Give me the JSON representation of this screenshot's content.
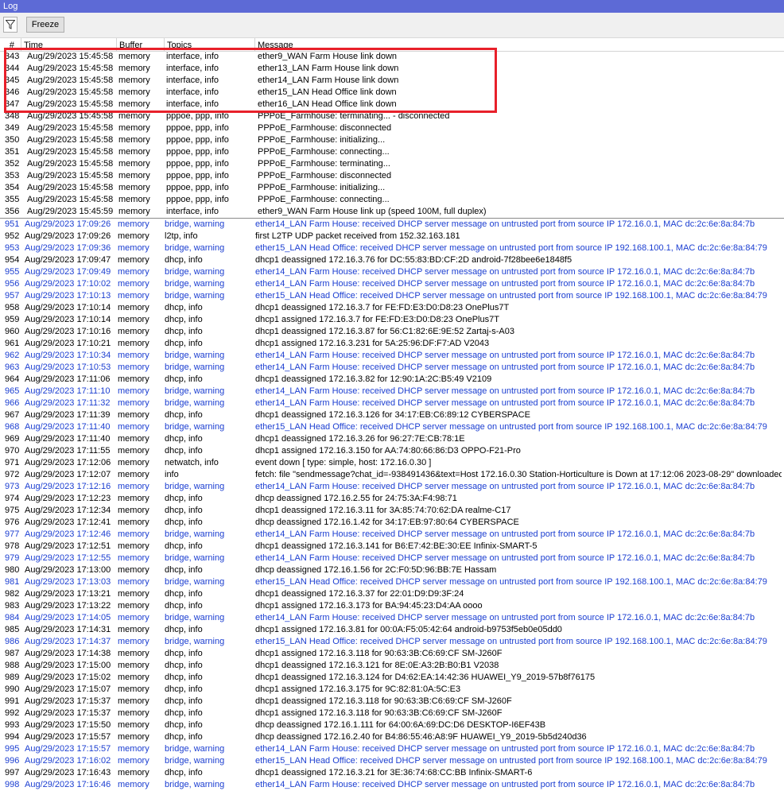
{
  "window": {
    "title": "Log"
  },
  "toolbar": {
    "freeze_label": "Freeze"
  },
  "columns": {
    "num": "#",
    "time": "Time",
    "buffer": "Buffer",
    "topics": "Topics",
    "message": "Message"
  },
  "colors": {
    "titlebar": "#5d6ad6",
    "highlight": "#e8202a",
    "warning_text": "#1b3ed1"
  },
  "rows": [
    {
      "n": "343",
      "t": "Aug/29/2023 15:45:58",
      "b": "memory",
      "tp": "interface, info",
      "m": "ether9_WAN Farm House link down",
      "w": false
    },
    {
      "n": "344",
      "t": "Aug/29/2023 15:45:58",
      "b": "memory",
      "tp": "interface, info",
      "m": "ether13_LAN Farm House link down",
      "w": false
    },
    {
      "n": "345",
      "t": "Aug/29/2023 15:45:58",
      "b": "memory",
      "tp": "interface, info",
      "m": "ether14_LAN Farm House link down",
      "w": false
    },
    {
      "n": "346",
      "t": "Aug/29/2023 15:45:58",
      "b": "memory",
      "tp": "interface, info",
      "m": "ether15_LAN Head Office link down",
      "w": false
    },
    {
      "n": "347",
      "t": "Aug/29/2023 15:45:58",
      "b": "memory",
      "tp": "interface, info",
      "m": "ether16_LAN Head Office link down",
      "w": false
    },
    {
      "n": "348",
      "t": "Aug/29/2023 15:45:58",
      "b": "memory",
      "tp": "pppoe, ppp, info",
      "m": "PPPoE_Farmhouse: terminating... - disconnected",
      "w": false
    },
    {
      "n": "349",
      "t": "Aug/29/2023 15:45:58",
      "b": "memory",
      "tp": "pppoe, ppp, info",
      "m": "PPPoE_Farmhouse: disconnected",
      "w": false
    },
    {
      "n": "350",
      "t": "Aug/29/2023 15:45:58",
      "b": "memory",
      "tp": "pppoe, ppp, info",
      "m": "PPPoE_Farmhouse: initializing...",
      "w": false
    },
    {
      "n": "351",
      "t": "Aug/29/2023 15:45:58",
      "b": "memory",
      "tp": "pppoe, ppp, info",
      "m": "PPPoE_Farmhouse: connecting...",
      "w": false
    },
    {
      "n": "352",
      "t": "Aug/29/2023 15:45:58",
      "b": "memory",
      "tp": "pppoe, ppp, info",
      "m": "PPPoE_Farmhouse: terminating...",
      "w": false
    },
    {
      "n": "353",
      "t": "Aug/29/2023 15:45:58",
      "b": "memory",
      "tp": "pppoe, ppp, info",
      "m": "PPPoE_Farmhouse: disconnected",
      "w": false
    },
    {
      "n": "354",
      "t": "Aug/29/2023 15:45:58",
      "b": "memory",
      "tp": "pppoe, ppp, info",
      "m": "PPPoE_Farmhouse: initializing...",
      "w": false
    },
    {
      "n": "355",
      "t": "Aug/29/2023 15:45:58",
      "b": "memory",
      "tp": "pppoe, ppp, info",
      "m": "PPPoE_Farmhouse: connecting...",
      "w": false
    },
    {
      "n": "356",
      "t": "Aug/29/2023 15:45:59",
      "b": "memory",
      "tp": "interface, info",
      "m": "ether9_WAN Farm House link up (speed 100M, full duplex)",
      "w": false
    },
    {
      "n": "951",
      "t": "Aug/29/2023 17:09:26",
      "b": "memory",
      "tp": "bridge, warning",
      "m": "ether14_LAN Farm House: received DHCP server message on untrusted port from source IP 172.16.0.1, MAC dc:2c:6e:8a:84:7b",
      "w": true
    },
    {
      "n": "952",
      "t": "Aug/29/2023 17:09:26",
      "b": "memory",
      "tp": "l2tp, info",
      "m": "first L2TP UDP packet received from 152.32.163.181",
      "w": false
    },
    {
      "n": "953",
      "t": "Aug/29/2023 17:09:36",
      "b": "memory",
      "tp": "bridge, warning",
      "m": "ether15_LAN Head Office: received DHCP server message on untrusted port from source IP 192.168.100.1, MAC dc:2c:6e:8a:84:79",
      "w": true
    },
    {
      "n": "954",
      "t": "Aug/29/2023 17:09:47",
      "b": "memory",
      "tp": "dhcp, info",
      "m": "dhcp1 deassigned 172.16.3.76 for DC:55:83:BD:CF:2D android-7f28bee6e1848f5",
      "w": false
    },
    {
      "n": "955",
      "t": "Aug/29/2023 17:09:49",
      "b": "memory",
      "tp": "bridge, warning",
      "m": "ether14_LAN Farm House: received DHCP server message on untrusted port from source IP 172.16.0.1, MAC dc:2c:6e:8a:84:7b",
      "w": true
    },
    {
      "n": "956",
      "t": "Aug/29/2023 17:10:02",
      "b": "memory",
      "tp": "bridge, warning",
      "m": "ether14_LAN Farm House: received DHCP server message on untrusted port from source IP 172.16.0.1, MAC dc:2c:6e:8a:84:7b",
      "w": true
    },
    {
      "n": "957",
      "t": "Aug/29/2023 17:10:13",
      "b": "memory",
      "tp": "bridge, warning",
      "m": "ether15_LAN Head Office: received DHCP server message on untrusted port from source IP 192.168.100.1, MAC dc:2c:6e:8a:84:79",
      "w": true
    },
    {
      "n": "958",
      "t": "Aug/29/2023 17:10:14",
      "b": "memory",
      "tp": "dhcp, info",
      "m": "dhcp1 deassigned 172.16.3.7 for FE:FD:E3:D0:D8:23 OnePlus7T",
      "w": false
    },
    {
      "n": "959",
      "t": "Aug/29/2023 17:10:14",
      "b": "memory",
      "tp": "dhcp, info",
      "m": "dhcp1 assigned 172.16.3.7 for FE:FD:E3:D0:D8:23 OnePlus7T",
      "w": false
    },
    {
      "n": "960",
      "t": "Aug/29/2023 17:10:16",
      "b": "memory",
      "tp": "dhcp, info",
      "m": "dhcp1 deassigned 172.16.3.87 for 56:C1:82:6E:9E:52 Zartaj-s-A03",
      "w": false
    },
    {
      "n": "961",
      "t": "Aug/29/2023 17:10:21",
      "b": "memory",
      "tp": "dhcp, info",
      "m": "dhcp1 assigned 172.16.3.231 for 5A:25:96:DF:F7:AD V2043",
      "w": false
    },
    {
      "n": "962",
      "t": "Aug/29/2023 17:10:34",
      "b": "memory",
      "tp": "bridge, warning",
      "m": "ether14_LAN Farm House: received DHCP server message on untrusted port from source IP 172.16.0.1, MAC dc:2c:6e:8a:84:7b",
      "w": true
    },
    {
      "n": "963",
      "t": "Aug/29/2023 17:10:53",
      "b": "memory",
      "tp": "bridge, warning",
      "m": "ether14_LAN Farm House: received DHCP server message on untrusted port from source IP 172.16.0.1, MAC dc:2c:6e:8a:84:7b",
      "w": true
    },
    {
      "n": "964",
      "t": "Aug/29/2023 17:11:06",
      "b": "memory",
      "tp": "dhcp, info",
      "m": "dhcp1 deassigned 172.16.3.82 for 12:90:1A:2C:B5:49 V2109",
      "w": false
    },
    {
      "n": "965",
      "t": "Aug/29/2023 17:11:10",
      "b": "memory",
      "tp": "bridge, warning",
      "m": "ether14_LAN Farm House: received DHCP server message on untrusted port from source IP 172.16.0.1, MAC dc:2c:6e:8a:84:7b",
      "w": true
    },
    {
      "n": "966",
      "t": "Aug/29/2023 17:11:32",
      "b": "memory",
      "tp": "bridge, warning",
      "m": "ether14_LAN Farm House: received DHCP server message on untrusted port from source IP 172.16.0.1, MAC dc:2c:6e:8a:84:7b",
      "w": true
    },
    {
      "n": "967",
      "t": "Aug/29/2023 17:11:39",
      "b": "memory",
      "tp": "dhcp, info",
      "m": "dhcp1 deassigned 172.16.3.126 for 34:17:EB:C6:89:12 CYBERSPACE",
      "w": false
    },
    {
      "n": "968",
      "t": "Aug/29/2023 17:11:40",
      "b": "memory",
      "tp": "bridge, warning",
      "m": "ether15_LAN Head Office: received DHCP server message on untrusted port from source IP 192.168.100.1, MAC dc:2c:6e:8a:84:79",
      "w": true
    },
    {
      "n": "969",
      "t": "Aug/29/2023 17:11:40",
      "b": "memory",
      "tp": "dhcp, info",
      "m": "dhcp1 deassigned 172.16.3.26 for 96:27:7E:CB:78:1E",
      "w": false
    },
    {
      "n": "970",
      "t": "Aug/29/2023 17:11:55",
      "b": "memory",
      "tp": "dhcp, info",
      "m": "dhcp1 assigned 172.16.3.150 for AA:74:80:66:86:D3 OPPO-F21-Pro",
      "w": false
    },
    {
      "n": "971",
      "t": "Aug/29/2023 17:12:06",
      "b": "memory",
      "tp": "netwatch, info",
      "m": "event down [ type: simple, host: 172.16.0.30 ]",
      "w": false
    },
    {
      "n": "972",
      "t": "Aug/29/2023 17:12:07",
      "b": "memory",
      "tp": "info",
      "m": "fetch: file \"sendmessage?chat_id=-938491436&text=Host 172.16.0.30 Station-Horticulture is Down at 17:12:06 2023-08-29\" downloaded",
      "w": false
    },
    {
      "n": "973",
      "t": "Aug/29/2023 17:12:16",
      "b": "memory",
      "tp": "bridge, warning",
      "m": "ether14_LAN Farm House: received DHCP server message on untrusted port from source IP 172.16.0.1, MAC dc:2c:6e:8a:84:7b",
      "w": true
    },
    {
      "n": "974",
      "t": "Aug/29/2023 17:12:23",
      "b": "memory",
      "tp": "dhcp, info",
      "m": "dhcp deassigned 172.16.2.55 for 24:75:3A:F4:98:71",
      "w": false
    },
    {
      "n": "975",
      "t": "Aug/29/2023 17:12:34",
      "b": "memory",
      "tp": "dhcp, info",
      "m": "dhcp1 deassigned 172.16.3.11 for 3A:85:74:70:62:DA realme-C17",
      "w": false
    },
    {
      "n": "976",
      "t": "Aug/29/2023 17:12:41",
      "b": "memory",
      "tp": "dhcp, info",
      "m": "dhcp deassigned 172.16.1.42 for 34:17:EB:97:80:64 CYBERSPACE",
      "w": false
    },
    {
      "n": "977",
      "t": "Aug/29/2023 17:12:46",
      "b": "memory",
      "tp": "bridge, warning",
      "m": "ether14_LAN Farm House: received DHCP server message on untrusted port from source IP 172.16.0.1, MAC dc:2c:6e:8a:84:7b",
      "w": true
    },
    {
      "n": "978",
      "t": "Aug/29/2023 17:12:51",
      "b": "memory",
      "tp": "dhcp, info",
      "m": "dhcp1 deassigned 172.16.3.141 for B6:E7:42:BE:30:EE Infinix-SMART-5",
      "w": false
    },
    {
      "n": "979",
      "t": "Aug/29/2023 17:12:55",
      "b": "memory",
      "tp": "bridge, warning",
      "m": "ether14_LAN Farm House: received DHCP server message on untrusted port from source IP 172.16.0.1, MAC dc:2c:6e:8a:84:7b",
      "w": true
    },
    {
      "n": "980",
      "t": "Aug/29/2023 17:13:00",
      "b": "memory",
      "tp": "dhcp, info",
      "m": "dhcp deassigned 172.16.1.56 for 2C:F0:5D:96:BB:7E Hassam",
      "w": false
    },
    {
      "n": "981",
      "t": "Aug/29/2023 17:13:03",
      "b": "memory",
      "tp": "bridge, warning",
      "m": "ether15_LAN Head Office: received DHCP server message on untrusted port from source IP 192.168.100.1, MAC dc:2c:6e:8a:84:79",
      "w": true
    },
    {
      "n": "982",
      "t": "Aug/29/2023 17:13:21",
      "b": "memory",
      "tp": "dhcp, info",
      "m": "dhcp1 deassigned 172.16.3.37 for 22:01:D9:D9:3F:24",
      "w": false
    },
    {
      "n": "983",
      "t": "Aug/29/2023 17:13:22",
      "b": "memory",
      "tp": "dhcp, info",
      "m": "dhcp1 assigned 172.16.3.173 for BA:94:45:23:D4:AA oooo",
      "w": false
    },
    {
      "n": "984",
      "t": "Aug/29/2023 17:14:05",
      "b": "memory",
      "tp": "bridge, warning",
      "m": "ether14_LAN Farm House: received DHCP server message on untrusted port from source IP 172.16.0.1, MAC dc:2c:6e:8a:84:7b",
      "w": true
    },
    {
      "n": "985",
      "t": "Aug/29/2023 17:14:31",
      "b": "memory",
      "tp": "dhcp, info",
      "m": "dhcp1 assigned 172.16.3.81 for 00:0A:F5:05:42:64 android-b9753f5eb0e05dd0",
      "w": false
    },
    {
      "n": "986",
      "t": "Aug/29/2023 17:14:37",
      "b": "memory",
      "tp": "bridge, warning",
      "m": "ether15_LAN Head Office: received DHCP server message on untrusted port from source IP 192.168.100.1, MAC dc:2c:6e:8a:84:79",
      "w": true
    },
    {
      "n": "987",
      "t": "Aug/29/2023 17:14:38",
      "b": "memory",
      "tp": "dhcp, info",
      "m": "dhcp1 assigned 172.16.3.118 for 90:63:3B:C6:69:CF SM-J260F",
      "w": false
    },
    {
      "n": "988",
      "t": "Aug/29/2023 17:15:00",
      "b": "memory",
      "tp": "dhcp, info",
      "m": "dhcp1 deassigned 172.16.3.121 for 8E:0E:A3:2B:B0:B1 V2038",
      "w": false
    },
    {
      "n": "989",
      "t": "Aug/29/2023 17:15:02",
      "b": "memory",
      "tp": "dhcp, info",
      "m": "dhcp1 deassigned 172.16.3.124 for D4:62:EA:14:42:36 HUAWEI_Y9_2019-57b8f76175",
      "w": false
    },
    {
      "n": "990",
      "t": "Aug/29/2023 17:15:07",
      "b": "memory",
      "tp": "dhcp, info",
      "m": "dhcp1 assigned 172.16.3.175 for 9C:82:81:0A:5C:E3",
      "w": false
    },
    {
      "n": "991",
      "t": "Aug/29/2023 17:15:37",
      "b": "memory",
      "tp": "dhcp, info",
      "m": "dhcp1 deassigned 172.16.3.118 for 90:63:3B:C6:69:CF SM-J260F",
      "w": false
    },
    {
      "n": "992",
      "t": "Aug/29/2023 17:15:37",
      "b": "memory",
      "tp": "dhcp, info",
      "m": "dhcp1 assigned 172.16.3.118 for 90:63:3B:C6:69:CF SM-J260F",
      "w": false
    },
    {
      "n": "993",
      "t": "Aug/29/2023 17:15:50",
      "b": "memory",
      "tp": "dhcp, info",
      "m": "dhcp deassigned 172.16.1.111 for 64:00:6A:69:DC:D6 DESKTOP-I6EF43B",
      "w": false
    },
    {
      "n": "994",
      "t": "Aug/29/2023 17:15:57",
      "b": "memory",
      "tp": "dhcp, info",
      "m": "dhcp deassigned 172.16.2.40 for B4:86:55:46:A8:9F HUAWEI_Y9_2019-5b5d240d36",
      "w": false
    },
    {
      "n": "995",
      "t": "Aug/29/2023 17:15:57",
      "b": "memory",
      "tp": "bridge, warning",
      "m": "ether14_LAN Farm House: received DHCP server message on untrusted port from source IP 172.16.0.1, MAC dc:2c:6e:8a:84:7b",
      "w": true
    },
    {
      "n": "996",
      "t": "Aug/29/2023 17:16:02",
      "b": "memory",
      "tp": "bridge, warning",
      "m": "ether15_LAN Head Office: received DHCP server message on untrusted port from source IP 192.168.100.1, MAC dc:2c:6e:8a:84:79",
      "w": true
    },
    {
      "n": "997",
      "t": "Aug/29/2023 17:16:43",
      "b": "memory",
      "tp": "dhcp, info",
      "m": "dhcp1 deassigned 172.16.3.21 for 3E:36:74:68:CC:BB Infinix-SMART-6",
      "w": false
    },
    {
      "n": "998",
      "t": "Aug/29/2023 17:16:46",
      "b": "memory",
      "tp": "bridge, warning",
      "m": "ether14_LAN Farm House: received DHCP server message on untrusted port from source IP 172.16.0.1, MAC dc:2c:6e:8a:84:7b",
      "w": true
    }
  ]
}
